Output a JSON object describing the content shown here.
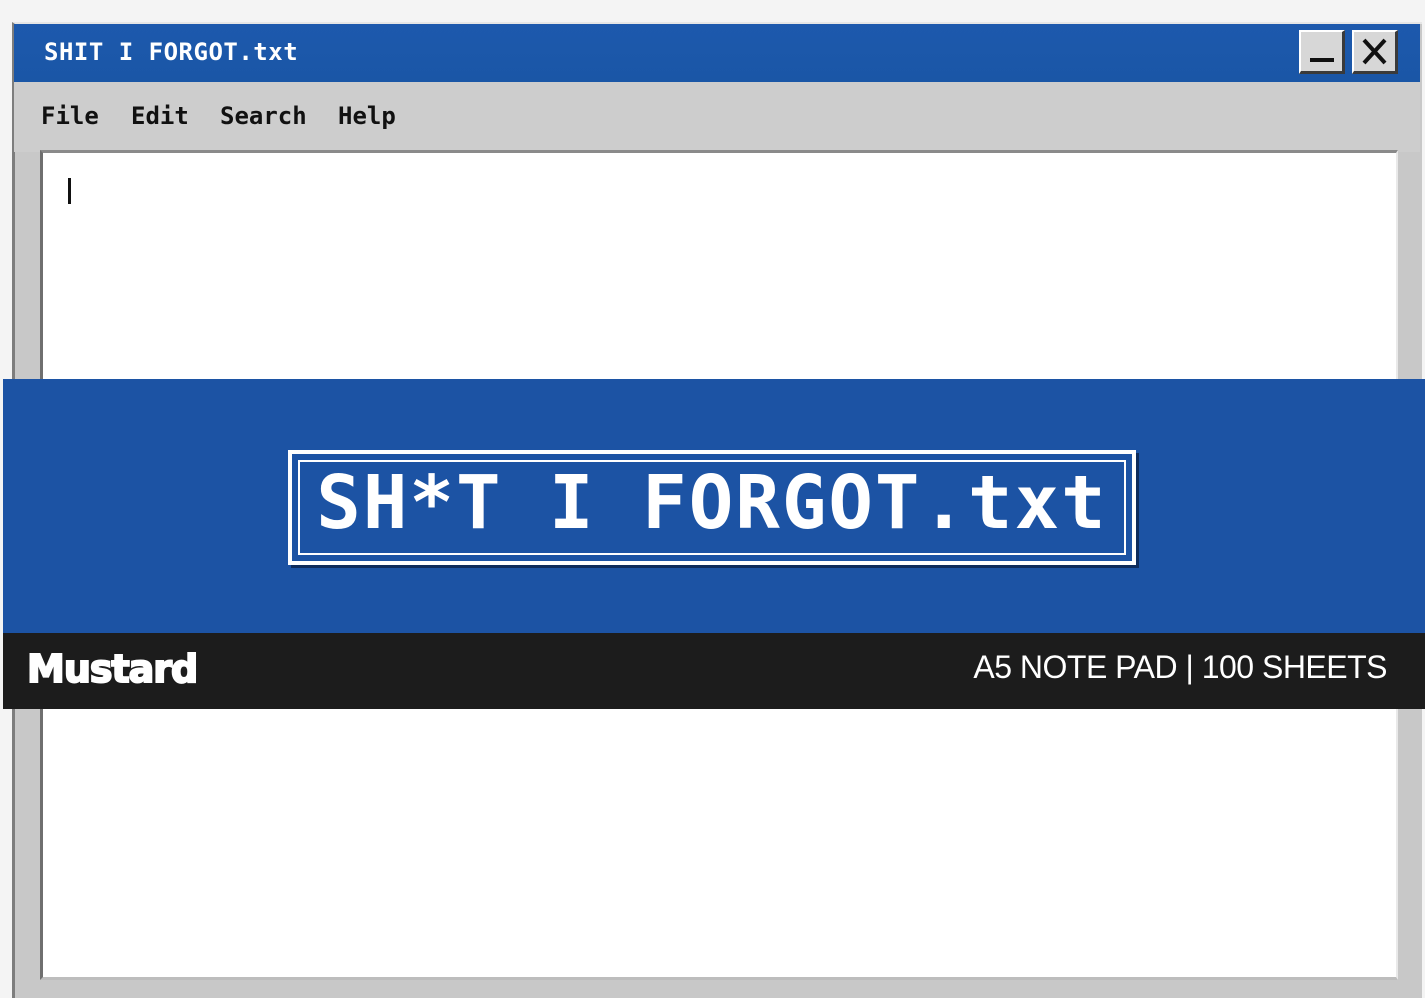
{
  "window": {
    "title": "SHIT I FORGOT.txt",
    "minimize_icon": "minimize-icon",
    "close_icon": "close-icon"
  },
  "menu": {
    "items": [
      {
        "label": "File"
      },
      {
        "label": "Edit"
      },
      {
        "label": "Search"
      },
      {
        "label": "Help"
      }
    ]
  },
  "editor": {
    "content": ""
  },
  "band": {
    "label": "SH*T I FORGOT.txt"
  },
  "footer": {
    "brand": "Mustard",
    "spec": "A5 NOTE PAD | 100 SHEETS"
  },
  "colors": {
    "titlebar": "#1d59ad",
    "band": "#1c53a4",
    "footer": "#1c1c1c",
    "chrome": "#c8c8c8"
  }
}
